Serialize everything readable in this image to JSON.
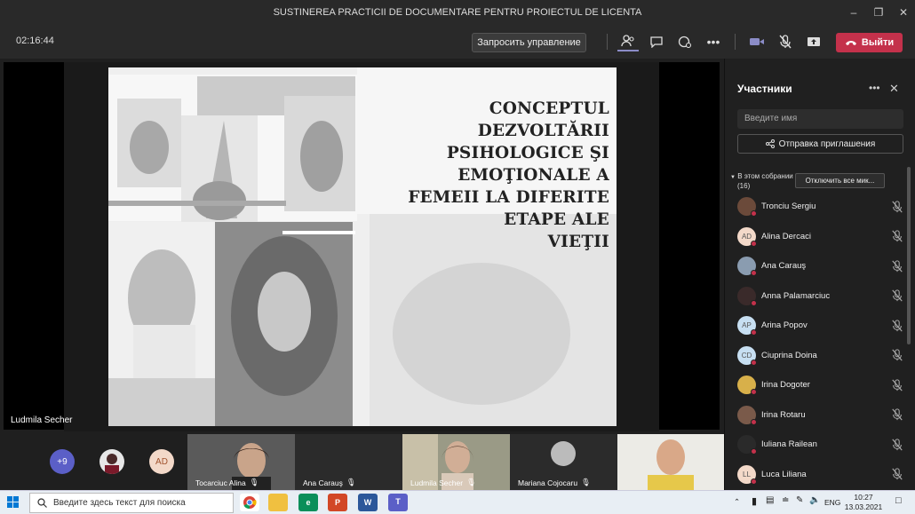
{
  "window": {
    "title": "SUSTINEREA PRACTICII DE DOCUMENTARE PENTRU PROIECTUL DE LICENTA"
  },
  "toolbar": {
    "timer": "02:16:44",
    "request_control_label": "Запросить управление",
    "leave_label": "Выйти"
  },
  "stage": {
    "presenter_name": "Ludmila Secher",
    "slide_title_lines": [
      "CONCEPTUL DEZVOLTĂRII",
      "PSIHOLOGICE ŞI",
      "EMOŢIONALE A",
      "FEMEII LA DIFERITE",
      "ETAPE ALE",
      "VIEŢII"
    ]
  },
  "panel": {
    "title": "Участники",
    "search_placeholder": "Введите имя",
    "invite_label": "Отправка приглашения",
    "section_label": "В этом собрании",
    "section_count": "(16)",
    "mute_all_label": "Отключить все мик...",
    "participants": [
      {
        "name": "Tronciu Sergiu",
        "initials": "",
        "color": "#6b4a3a"
      },
      {
        "name": "Alina Dercaci",
        "initials": "AD",
        "color": "#f3d9c9"
      },
      {
        "name": "Ana Carauş",
        "initials": "",
        "color": "#8a9cb0"
      },
      {
        "name": "Anna Palamarciuc",
        "initials": "",
        "color": "#3a2a2a"
      },
      {
        "name": "Arina Popov",
        "initials": "AP",
        "color": "#c7dff2"
      },
      {
        "name": "Ciuprina Doina",
        "initials": "CD",
        "color": "#c7dff2"
      },
      {
        "name": "Irina Dogoter",
        "initials": "",
        "color": "#d8b04a"
      },
      {
        "name": "Irina Rotaru",
        "initials": "",
        "color": "#7a5a4a"
      },
      {
        "name": "Iuliana Railean",
        "initials": "",
        "color": "#2a2a2a"
      },
      {
        "name": "Luca Liliana",
        "initials": "LL",
        "color": "#f3d9c9"
      }
    ]
  },
  "bottom": {
    "overflow_count": "+9",
    "chip_initials": "AD",
    "tiles": [
      {
        "name": "Tocarciuc Alina"
      },
      {
        "name": "Ana Carauş"
      },
      {
        "name": "Ludmila Secher"
      },
      {
        "name": "Mariana Cojocaru"
      },
      {
        "name": ""
      }
    ]
  },
  "taskbar": {
    "search_placeholder": "Введите здесь текст для поиска",
    "lang": "ENG",
    "time": "10:27",
    "date": "13.03.2021"
  }
}
